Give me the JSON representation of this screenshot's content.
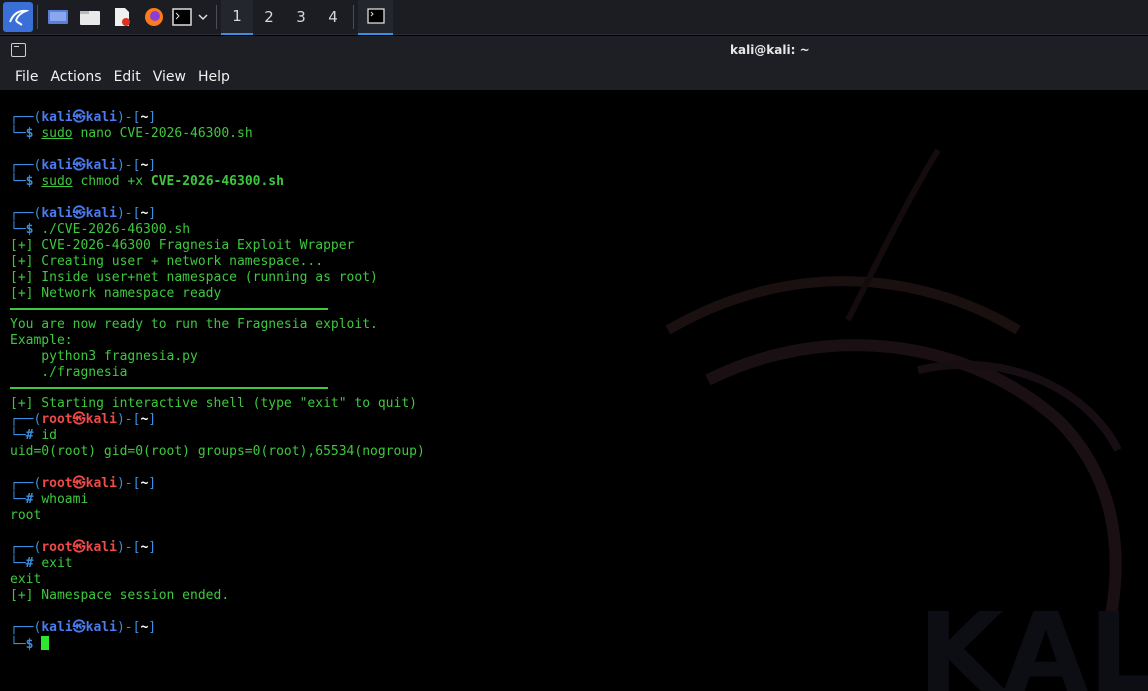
{
  "taskbar": {
    "workspaces": [
      "1",
      "2",
      "3",
      "4"
    ],
    "active_workspace": "1"
  },
  "window": {
    "title": "kali@kali: ~"
  },
  "menu": {
    "items": [
      "File",
      "Actions",
      "Edit",
      "View",
      "Help"
    ]
  },
  "prompt": {
    "user": "kali",
    "root_user": "root",
    "host": "kali",
    "at_symbol": "㉿",
    "path": "~",
    "user_sign": "$",
    "root_sign": "#"
  },
  "session": {
    "cmd1": {
      "sudo": "sudo",
      "rest": "nano CVE-2026-46300.sh"
    },
    "cmd2": {
      "sudo": "sudo",
      "rest": "chmod +x",
      "file": "CVE-2026-46300.sh"
    },
    "cmd3": "./CVE-2026-46300.sh",
    "out_wrapper": [
      "[+] CVE-2026-46300 Fragnesia Exploit Wrapper",
      "[+] Creating user + network namespace...",
      "[+] Inside user+net namespace (running as root)",
      "[+] Network namespace ready"
    ],
    "ready_msg": "You are now ready to run the Fragnesia exploit.",
    "example_label": "Example:",
    "example_1": "    python3 fragnesia.py",
    "example_2": "    ./fragnesia",
    "starting_shell": "[+] Starting interactive shell (type \"exit\" to quit)",
    "root_cmd1": "id",
    "id_output": "uid=0(root) gid=0(root) groups=0(root),65534(nogroup)",
    "root_cmd2": "whoami",
    "whoami_output": "root",
    "root_cmd3": "exit",
    "exit_output": "exit",
    "ended_msg": "[+] Namespace session ended."
  },
  "colors": {
    "accent": "#3a8fe0",
    "terminal_green": "#3ec83e",
    "root_red": "#ef4a4a",
    "user_blue": "#4a7cf0"
  }
}
